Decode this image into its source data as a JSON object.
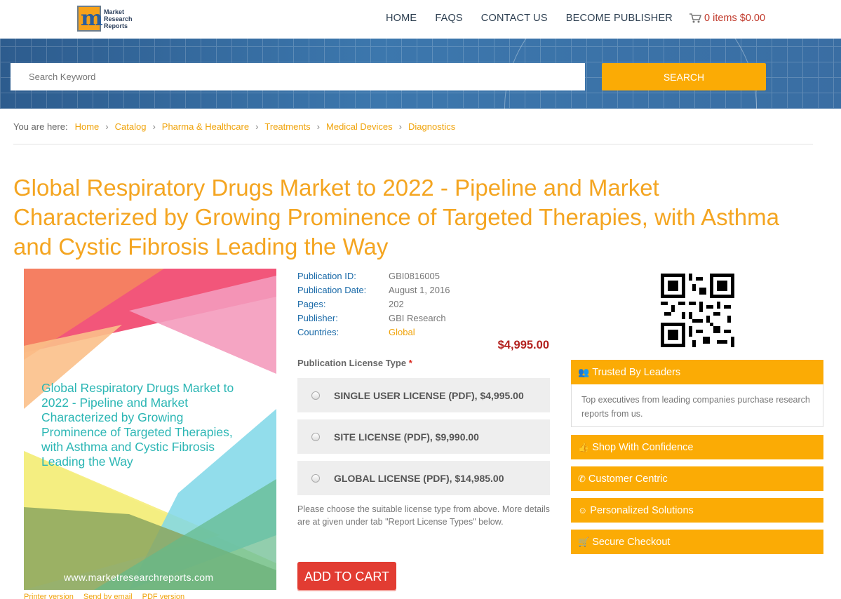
{
  "brand": {
    "logo_letter": "m",
    "logo_text_1": "Market",
    "logo_text_2": "Research",
    "logo_text_3": "Reports"
  },
  "nav": {
    "items": [
      "HOME",
      "FAQS",
      "CONTACT US",
      "BECOME PUBLISHER"
    ],
    "cart": "0 items $0.00"
  },
  "search": {
    "placeholder": "Search Keyword",
    "button": "SEARCH"
  },
  "breadcrumb": {
    "prefix": "You are here:",
    "items": [
      "Home",
      "Catalog",
      "Pharma & Healthcare",
      "Treatments",
      "Medical Devices",
      "Diagnostics"
    ]
  },
  "report": {
    "title": "Global Respiratory Drugs Market to 2022 - Pipeline and Market Characterized by Growing Prominence of Targeted Therapies, with Asthma and Cystic Fibrosis Leading the Way",
    "cover_text": "Global Respiratory Drugs Market to 2022 - Pipeline and Market Characterized by Growing Prominence of Targeted Therapies, with Asthma and Cystic Fibrosis Leading the Way",
    "cover_url": "www.marketresearchreports.com",
    "details": [
      {
        "label": "Publication ID:",
        "value": "GBI0816005"
      },
      {
        "label": "Publication Date:",
        "value": "August 1, 2016"
      },
      {
        "label": "Pages:",
        "value": "202"
      },
      {
        "label": "Publisher:",
        "value": "GBI Research"
      },
      {
        "label": "Countries:",
        "value": "Global"
      }
    ],
    "price": "$4,995.00",
    "license_label": "Publication License Type",
    "license_required": "*",
    "licenses": [
      "SINGLE USER LICENSE (PDF), $4,995.00",
      "SITE LICENSE (PDF), $9,990.00",
      "GLOBAL LICENSE (PDF), $14,985.00"
    ],
    "note": "Please choose the suitable license type from above. More details are at given under tab \"Report License Types\" below.",
    "add_to_cart": "ADD TO CART",
    "print_links": [
      "Printer version",
      "Send by email",
      "PDF version"
    ]
  },
  "sidebar": {
    "trusted_title": "Trusted By Leaders",
    "trusted_body": "Top executives from leading companies purchase research reports from us.",
    "panels": [
      "Shop With Confidence",
      "Customer Centric",
      "Personalized Solutions",
      "Secure Checkout"
    ]
  },
  "colors": {
    "accent": "#fbab05",
    "title": "#f4a521",
    "price": "#b3221f",
    "cart_button": "#e23c32",
    "link_blue": "#1a6aa8"
  }
}
